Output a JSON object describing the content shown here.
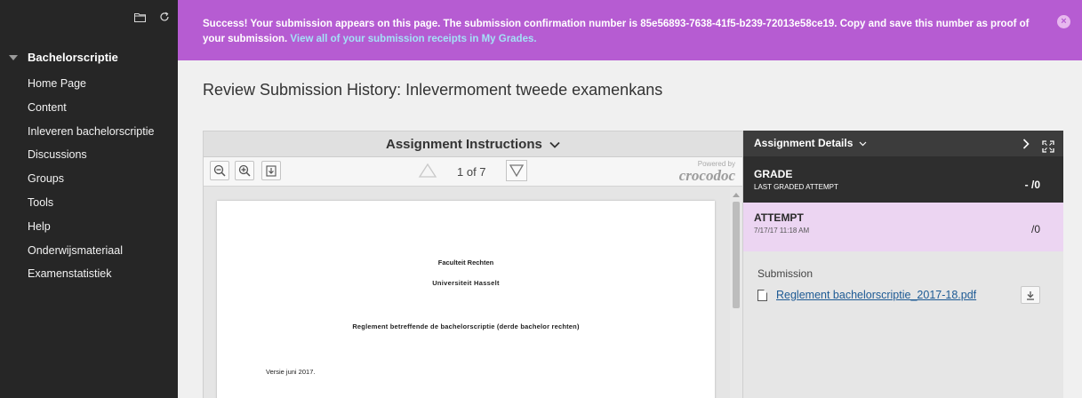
{
  "sidebar": {
    "course_title": "Bachelorscriptie",
    "items": [
      {
        "label": "Home Page"
      },
      {
        "label": "Content"
      },
      {
        "label": "Inleveren bachelorscriptie"
      },
      {
        "label": "Discussions"
      },
      {
        "label": "Groups"
      },
      {
        "label": "Tools"
      },
      {
        "label": "Help"
      },
      {
        "label": "Onderwijsmateriaal"
      },
      {
        "label": "Examenstatistiek"
      }
    ],
    "icons": [
      "folder-icon",
      "refresh-icon"
    ]
  },
  "banner": {
    "message": "Success! Your submission appears on this page. The submission confirmation number is 85e56893-7638-41f5-b239-72013e58ce19. Copy and save this number as proof of your submission.",
    "link": "View all of your submission receipts in My Grades.",
    "color": "#b65cd2"
  },
  "page": {
    "title": "Review Submission History: Inlevermoment tweede examenkans"
  },
  "viewer": {
    "header": "Assignment Instructions",
    "header_icon": "chevron-down-icon",
    "page_indicator": "1 of 7",
    "powered_by": "Powered by",
    "brand": "crocodoc",
    "document_lines": [
      "Faculteit Rechten",
      "Universiteit Hasselt",
      "Reglement betreffende de bachelorscriptie (derde bachelor rechten)",
      "Versie juni 2017."
    ]
  },
  "details": {
    "header": "Assignment Details",
    "grade": {
      "title": "GRADE",
      "subtitle": "LAST GRADED ATTEMPT",
      "score": "- /0"
    },
    "attempt": {
      "title": "ATTEMPT",
      "timestamp": "7/17/17 11:18 AM",
      "score": "/0"
    },
    "submission": {
      "label": "Submission",
      "file_name": "Reglement bachelorscriptie_2017-18.pdf"
    }
  }
}
